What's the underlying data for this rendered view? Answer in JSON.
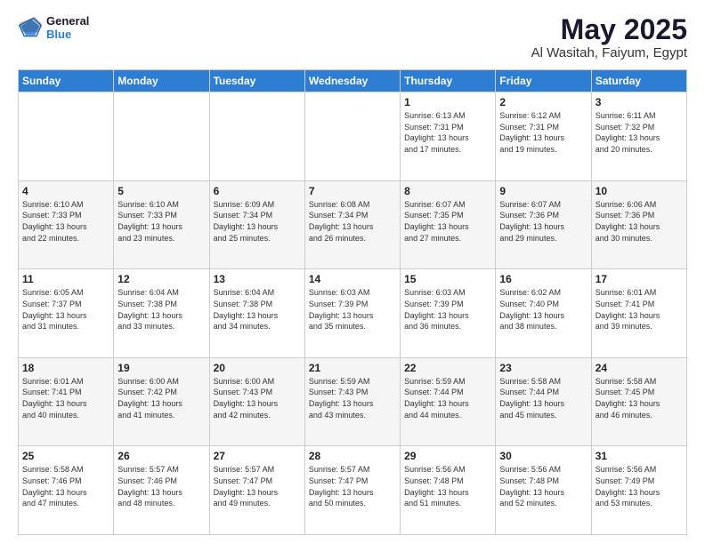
{
  "logo": {
    "line1": "General",
    "line2": "Blue"
  },
  "title": "May 2025",
  "subtitle": "Al Wasitah, Faiyum, Egypt",
  "days_header": [
    "Sunday",
    "Monday",
    "Tuesday",
    "Wednesday",
    "Thursday",
    "Friday",
    "Saturday"
  ],
  "weeks": [
    [
      {
        "day": "",
        "info": ""
      },
      {
        "day": "",
        "info": ""
      },
      {
        "day": "",
        "info": ""
      },
      {
        "day": "",
        "info": ""
      },
      {
        "day": "1",
        "info": "Sunrise: 6:13 AM\nSunset: 7:31 PM\nDaylight: 13 hours\nand 17 minutes."
      },
      {
        "day": "2",
        "info": "Sunrise: 6:12 AM\nSunset: 7:31 PM\nDaylight: 13 hours\nand 19 minutes."
      },
      {
        "day": "3",
        "info": "Sunrise: 6:11 AM\nSunset: 7:32 PM\nDaylight: 13 hours\nand 20 minutes."
      }
    ],
    [
      {
        "day": "4",
        "info": "Sunrise: 6:10 AM\nSunset: 7:33 PM\nDaylight: 13 hours\nand 22 minutes."
      },
      {
        "day": "5",
        "info": "Sunrise: 6:10 AM\nSunset: 7:33 PM\nDaylight: 13 hours\nand 23 minutes."
      },
      {
        "day": "6",
        "info": "Sunrise: 6:09 AM\nSunset: 7:34 PM\nDaylight: 13 hours\nand 25 minutes."
      },
      {
        "day": "7",
        "info": "Sunrise: 6:08 AM\nSunset: 7:34 PM\nDaylight: 13 hours\nand 26 minutes."
      },
      {
        "day": "8",
        "info": "Sunrise: 6:07 AM\nSunset: 7:35 PM\nDaylight: 13 hours\nand 27 minutes."
      },
      {
        "day": "9",
        "info": "Sunrise: 6:07 AM\nSunset: 7:36 PM\nDaylight: 13 hours\nand 29 minutes."
      },
      {
        "day": "10",
        "info": "Sunrise: 6:06 AM\nSunset: 7:36 PM\nDaylight: 13 hours\nand 30 minutes."
      }
    ],
    [
      {
        "day": "11",
        "info": "Sunrise: 6:05 AM\nSunset: 7:37 PM\nDaylight: 13 hours\nand 31 minutes."
      },
      {
        "day": "12",
        "info": "Sunrise: 6:04 AM\nSunset: 7:38 PM\nDaylight: 13 hours\nand 33 minutes."
      },
      {
        "day": "13",
        "info": "Sunrise: 6:04 AM\nSunset: 7:38 PM\nDaylight: 13 hours\nand 34 minutes."
      },
      {
        "day": "14",
        "info": "Sunrise: 6:03 AM\nSunset: 7:39 PM\nDaylight: 13 hours\nand 35 minutes."
      },
      {
        "day": "15",
        "info": "Sunrise: 6:03 AM\nSunset: 7:39 PM\nDaylight: 13 hours\nand 36 minutes."
      },
      {
        "day": "16",
        "info": "Sunrise: 6:02 AM\nSunset: 7:40 PM\nDaylight: 13 hours\nand 38 minutes."
      },
      {
        "day": "17",
        "info": "Sunrise: 6:01 AM\nSunset: 7:41 PM\nDaylight: 13 hours\nand 39 minutes."
      }
    ],
    [
      {
        "day": "18",
        "info": "Sunrise: 6:01 AM\nSunset: 7:41 PM\nDaylight: 13 hours\nand 40 minutes."
      },
      {
        "day": "19",
        "info": "Sunrise: 6:00 AM\nSunset: 7:42 PM\nDaylight: 13 hours\nand 41 minutes."
      },
      {
        "day": "20",
        "info": "Sunrise: 6:00 AM\nSunset: 7:43 PM\nDaylight: 13 hours\nand 42 minutes."
      },
      {
        "day": "21",
        "info": "Sunrise: 5:59 AM\nSunset: 7:43 PM\nDaylight: 13 hours\nand 43 minutes."
      },
      {
        "day": "22",
        "info": "Sunrise: 5:59 AM\nSunset: 7:44 PM\nDaylight: 13 hours\nand 44 minutes."
      },
      {
        "day": "23",
        "info": "Sunrise: 5:58 AM\nSunset: 7:44 PM\nDaylight: 13 hours\nand 45 minutes."
      },
      {
        "day": "24",
        "info": "Sunrise: 5:58 AM\nSunset: 7:45 PM\nDaylight: 13 hours\nand 46 minutes."
      }
    ],
    [
      {
        "day": "25",
        "info": "Sunrise: 5:58 AM\nSunset: 7:46 PM\nDaylight: 13 hours\nand 47 minutes."
      },
      {
        "day": "26",
        "info": "Sunrise: 5:57 AM\nSunset: 7:46 PM\nDaylight: 13 hours\nand 48 minutes."
      },
      {
        "day": "27",
        "info": "Sunrise: 5:57 AM\nSunset: 7:47 PM\nDaylight: 13 hours\nand 49 minutes."
      },
      {
        "day": "28",
        "info": "Sunrise: 5:57 AM\nSunset: 7:47 PM\nDaylight: 13 hours\nand 50 minutes."
      },
      {
        "day": "29",
        "info": "Sunrise: 5:56 AM\nSunset: 7:48 PM\nDaylight: 13 hours\nand 51 minutes."
      },
      {
        "day": "30",
        "info": "Sunrise: 5:56 AM\nSunset: 7:48 PM\nDaylight: 13 hours\nand 52 minutes."
      },
      {
        "day": "31",
        "info": "Sunrise: 5:56 AM\nSunset: 7:49 PM\nDaylight: 13 hours\nand 53 minutes."
      }
    ]
  ]
}
